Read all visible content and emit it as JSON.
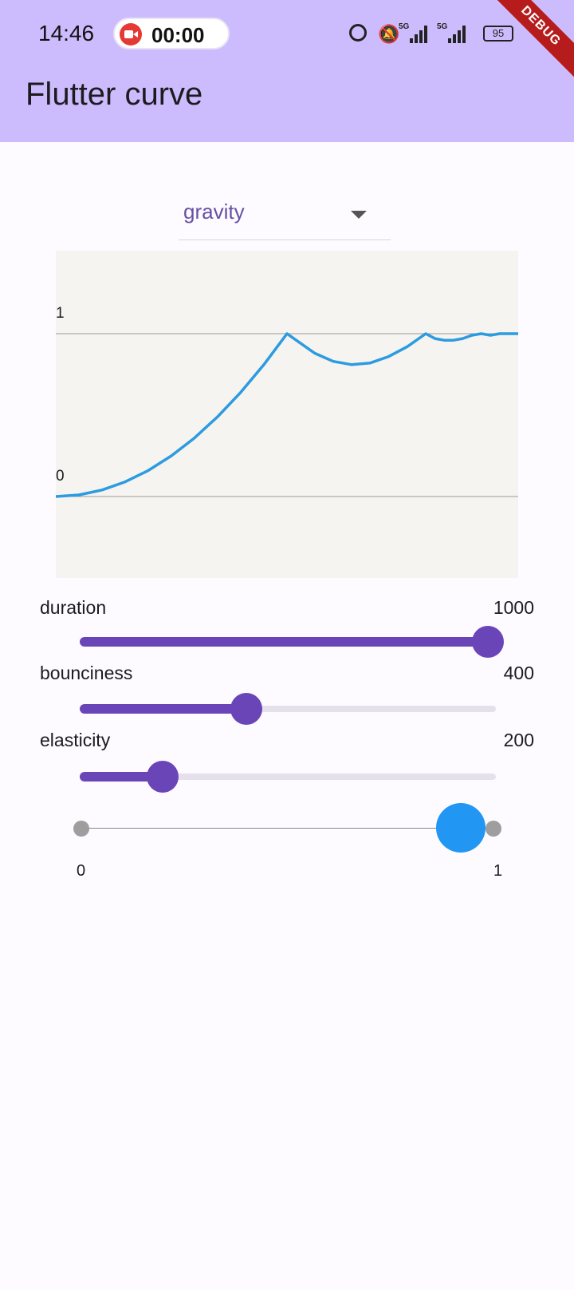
{
  "status_bar": {
    "time": "14:46",
    "recording_time": "00:00",
    "network1": "5G",
    "network2": "5G",
    "battery": "95"
  },
  "debug_banner": "DEBUG",
  "app_bar": {
    "title": "Flutter curve"
  },
  "curve_dropdown": {
    "selected": "gravity"
  },
  "chart_data": {
    "type": "line",
    "title": "",
    "xlabel": "",
    "ylabel": "",
    "y_tick_labels": [
      "1",
      "0"
    ],
    "ylim": [
      -0.45,
      1.45
    ],
    "xlim": [
      0,
      1
    ],
    "series": [
      {
        "x": [
          0,
          0.05,
          0.1,
          0.15,
          0.2,
          0.25,
          0.3,
          0.35,
          0.4,
          0.45,
          0.5,
          0.52,
          0.56,
          0.6,
          0.64,
          0.68,
          0.72,
          0.76,
          0.8,
          0.82,
          0.84,
          0.86,
          0.88,
          0.9,
          0.92,
          0.94,
          0.96,
          0.98,
          1.0
        ],
        "values": [
          0,
          0.01,
          0.04,
          0.09,
          0.16,
          0.25,
          0.36,
          0.49,
          0.64,
          0.81,
          1.0,
          0.96,
          0.88,
          0.83,
          0.81,
          0.82,
          0.86,
          0.92,
          1.0,
          0.97,
          0.96,
          0.96,
          0.97,
          0.99,
          1.0,
          0.99,
          1.0,
          1.0,
          1.0
        ],
        "color": "#2d9be0"
      }
    ],
    "reference_lines": [
      0,
      1
    ]
  },
  "sliders": [
    {
      "label": "duration",
      "value": "1000",
      "fraction": 1.0
    },
    {
      "label": "bounciness",
      "value": "400",
      "fraction": 0.4
    },
    {
      "label": "elasticity",
      "value": "200",
      "fraction": 0.2
    }
  ],
  "animation_preview": {
    "start_label": "0",
    "end_label": "1",
    "progress": 0.92,
    "ball_color": "#2196f3"
  },
  "colors": {
    "app_bar": "#cdbcfd",
    "accent": "#6a45b8",
    "dropdown_text": "#6750a4"
  },
  "icons": [
    "video-record-icon",
    "alarm-icon",
    "bell-off-icon",
    "signal-icon",
    "battery-icon",
    "dropdown-caret-icon"
  ]
}
